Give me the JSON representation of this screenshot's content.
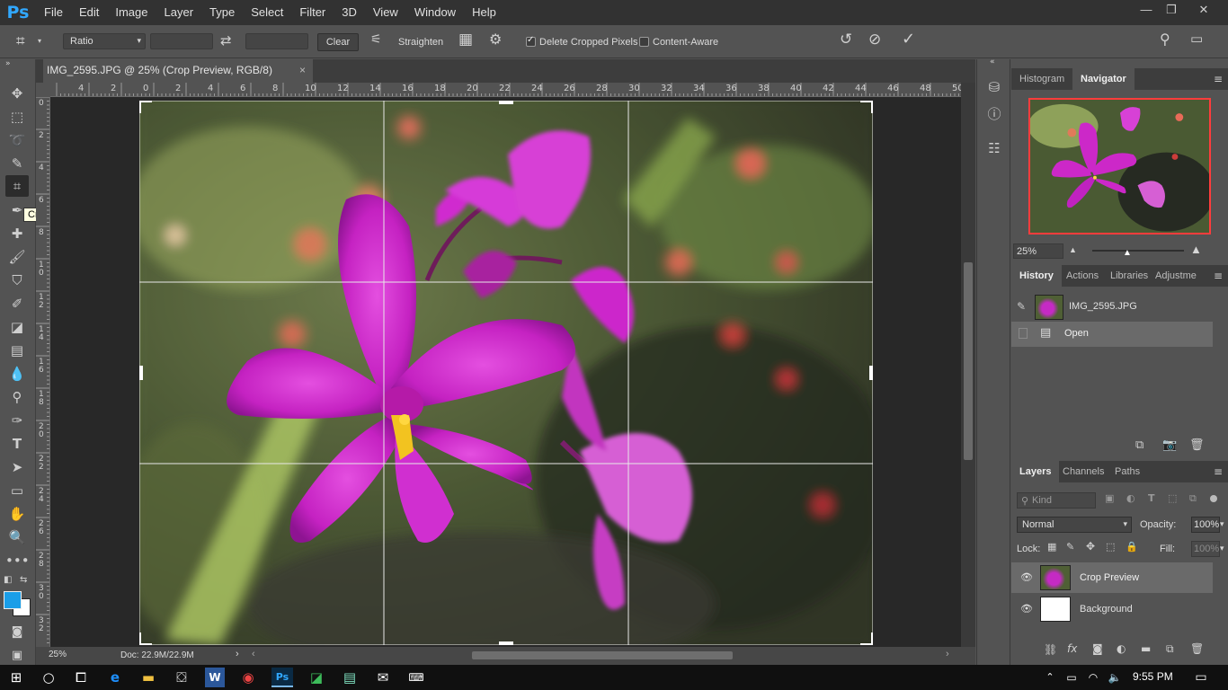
{
  "app": {
    "logo": "Ps"
  },
  "menu": {
    "items": [
      "File",
      "Edit",
      "Image",
      "Layer",
      "Type",
      "Select",
      "Filter",
      "3D",
      "View",
      "Window",
      "Help"
    ]
  },
  "window_controls": {
    "minimize": "—",
    "restore": "❐",
    "close": "✕"
  },
  "options_bar": {
    "ratio_select": "Ratio",
    "clear_label": "Clear",
    "straighten_label": "Straighten",
    "delete_cropped_label": "Delete Cropped Pixels",
    "delete_cropped_checked": true,
    "content_aware_label": "Content-Aware",
    "content_aware_checked": false
  },
  "document": {
    "tab_title": "IMG_2595.JPG @ 25% (Crop Preview, RGB/8)",
    "close": "×"
  },
  "tooltip": "Crop Tool (C)",
  "ruler": {
    "h_labels": [
      "4",
      "2",
      "0",
      "2",
      "4",
      "6",
      "8",
      "10",
      "12",
      "14",
      "16",
      "18",
      "20",
      "22",
      "24",
      "26",
      "28",
      "30",
      "32",
      "34",
      "36",
      "38",
      "40",
      "42",
      "44",
      "46",
      "48",
      "50"
    ],
    "v_labels": [
      "0",
      "2",
      "4",
      "6",
      "8",
      "1\n0",
      "1\n2",
      "1\n4",
      "1\n6",
      "1\n8",
      "2\n0",
      "2\n2",
      "2\n4",
      "2\n6",
      "2\n8",
      "3\n0",
      "3\n2"
    ]
  },
  "status": {
    "zoom": "25%",
    "doc": "Doc: 22.9M/22.9M"
  },
  "navigator": {
    "tabs": [
      "Histogram",
      "Navigator"
    ],
    "active_tab": "Navigator",
    "zoom": "25%"
  },
  "history": {
    "tabs": [
      "History",
      "Actions",
      "Libraries",
      "Adjustme"
    ],
    "snapshot": "IMG_2595.JPG",
    "states": [
      "Open"
    ]
  },
  "layers": {
    "tabs": [
      "Layers",
      "Channels",
      "Paths"
    ],
    "kind_placeholder": "Kind",
    "blend_mode": "Normal",
    "opacity_label": "Opacity:",
    "opacity": "100%",
    "lock_label": "Lock:",
    "fill_label": "Fill:",
    "fill": "100%",
    "items": [
      {
        "name": "Crop Preview",
        "selected": true
      },
      {
        "name": "Background",
        "selected": false
      }
    ]
  },
  "taskbar": {
    "time": "9:55 PM"
  },
  "colors": {
    "accent": "#31a8ff",
    "foreground_swatch": "#1a9ee8",
    "background_swatch": "#ffffff",
    "navigator_frame": "#ff3c3c"
  }
}
